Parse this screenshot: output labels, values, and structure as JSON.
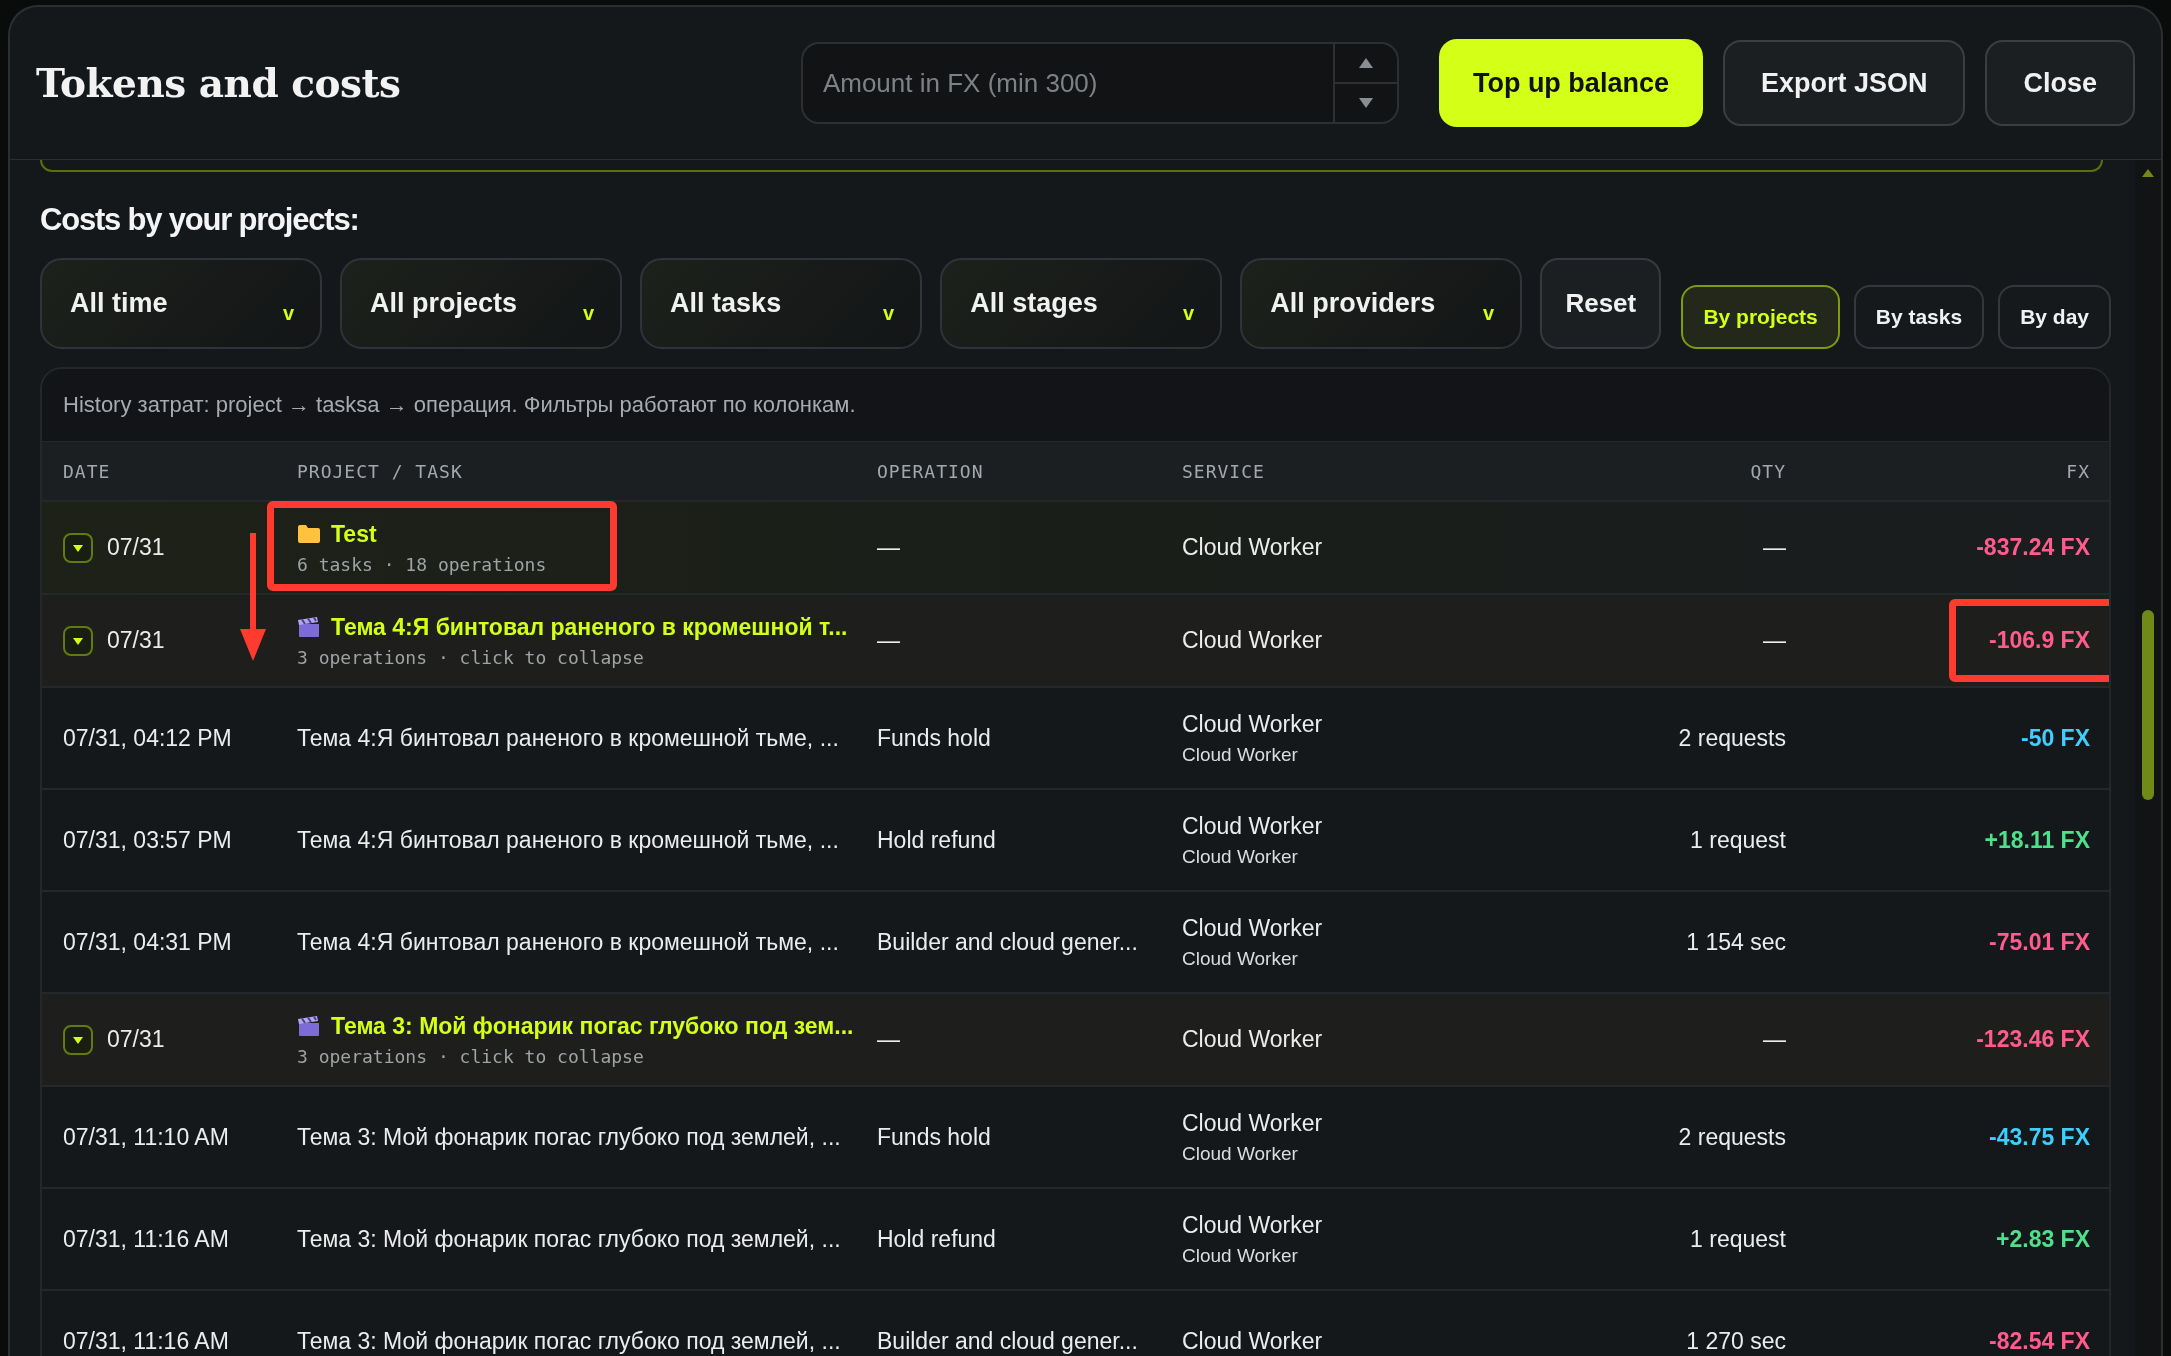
{
  "window": {
    "title": "Tokens and costs"
  },
  "amount_field": {
    "placeholder": "Amount in FX (min 300)"
  },
  "actions": [
    {
      "label": "Top up balance",
      "kind": "primary"
    },
    {
      "label": "Export JSON",
      "kind": "secondary"
    },
    {
      "label": "Close",
      "kind": "secondary"
    }
  ],
  "section_title": "Costs by your projects:",
  "filters": [
    {
      "label": "All time",
      "caret": "v"
    },
    {
      "label": "All projects",
      "caret": "v"
    },
    {
      "label": "All tasks",
      "caret": "v"
    },
    {
      "label": "All stages",
      "caret": "v"
    },
    {
      "label": "All providers",
      "caret": "v"
    }
  ],
  "reset": {
    "label": "Reset"
  },
  "views": [
    {
      "label": "By projects",
      "selected": true
    },
    {
      "label": "By tasks",
      "selected": false
    },
    {
      "label": "By day",
      "selected": false
    }
  ],
  "table": {
    "caption": "History затрат: project → tasksa → операция. Фильтры работают по колонкам.",
    "columns": [
      "DATE",
      "PROJECT / TASK",
      "OPERATION",
      "SERVICE",
      "QTY",
      "FX"
    ],
    "rows": [
      {
        "kind": "project",
        "expanded": true,
        "date": "07/31",
        "title": "Test",
        "meta": "6 tasks · 18 operations",
        "operation": "—",
        "service": "Cloud Worker",
        "qty": "—",
        "fx": {
          "text": "-837.24 FX",
          "color": "#ff5c8d"
        },
        "boxed_title": true
      },
      {
        "kind": "task",
        "expanded": true,
        "date": "07/31",
        "title": "Тема 4:Я бинтовал раненого в кромешной т...",
        "meta": "3 operations · click to collapse",
        "operation": "—",
        "service": "Cloud Worker",
        "qty": "—",
        "fx": {
          "text": "-106.9 FX",
          "color": "#ff5c8d"
        },
        "boxed_amount": true,
        "arrow_above": true
      },
      {
        "kind": "operation",
        "date": "07/31, 04:12 PM",
        "title": "Тема 4:Я бинтовал раненого в кромешной тьме, ...",
        "operation": "Funds hold",
        "service": "Cloud Worker",
        "provider": "Cloud Worker",
        "qty": "2 requests",
        "fx": {
          "text": "-50 FX",
          "color": "#3ccfff"
        }
      },
      {
        "kind": "operation",
        "date": "07/31, 03:57 PM",
        "title": "Тема 4:Я бинтовал раненого в кромешной тьме, ...",
        "operation": "Hold refund",
        "service": "Cloud Worker",
        "provider": "Cloud Worker",
        "qty": "1 request",
        "fx": {
          "text": "+18.11 FX",
          "color": "#4fe08c"
        }
      },
      {
        "kind": "operation",
        "date": "07/31, 04:31 PM",
        "title": "Тема 4:Я бинтовал раненого в кромешной тьме, ...",
        "operation": "Builder and cloud gener...",
        "service": "Cloud Worker",
        "provider": "Cloud Worker",
        "qty": "1 154 sec",
        "fx": {
          "text": "-75.01 FX",
          "color": "#ff5c8d"
        }
      },
      {
        "kind": "task",
        "expanded": true,
        "date": "07/31",
        "title": "Тема 3: Мой фонарик погас глубоко под зем...",
        "meta": "3 operations · click to collapse",
        "operation": "—",
        "service": "Cloud Worker",
        "qty": "—",
        "fx": {
          "text": "-123.46 FX",
          "color": "#ff5c8d"
        }
      },
      {
        "kind": "operation",
        "date": "07/31, 11:10 AM",
        "title": "Тема 3: Мой фонарик погас глубоко под землей, ...",
        "operation": "Funds hold",
        "service": "Cloud Worker",
        "provider": "Cloud Worker",
        "qty": "2 requests",
        "fx": {
          "text": "-43.75 FX",
          "color": "#3ccfff"
        }
      },
      {
        "kind": "operation",
        "date": "07/31, 11:16 AM",
        "title": "Тема 3: Мой фонарик погас глубоко под землей, ...",
        "operation": "Hold refund",
        "service": "Cloud Worker",
        "provider": "Cloud Worker",
        "qty": "1 request",
        "fx": {
          "text": "+2.83 FX",
          "color": "#4fe08c"
        }
      },
      {
        "kind": "operation",
        "date": "07/31, 11:16 AM",
        "title": "Тема 3: Мой фонарик погас глубоко под землей, ...",
        "operation": "Builder and cloud gener...",
        "service": "Cloud Worker",
        "qty": "1 270 sec",
        "fx": {
          "text": "-82.54 FX",
          "color": "#ff5c8d"
        }
      }
    ]
  }
}
